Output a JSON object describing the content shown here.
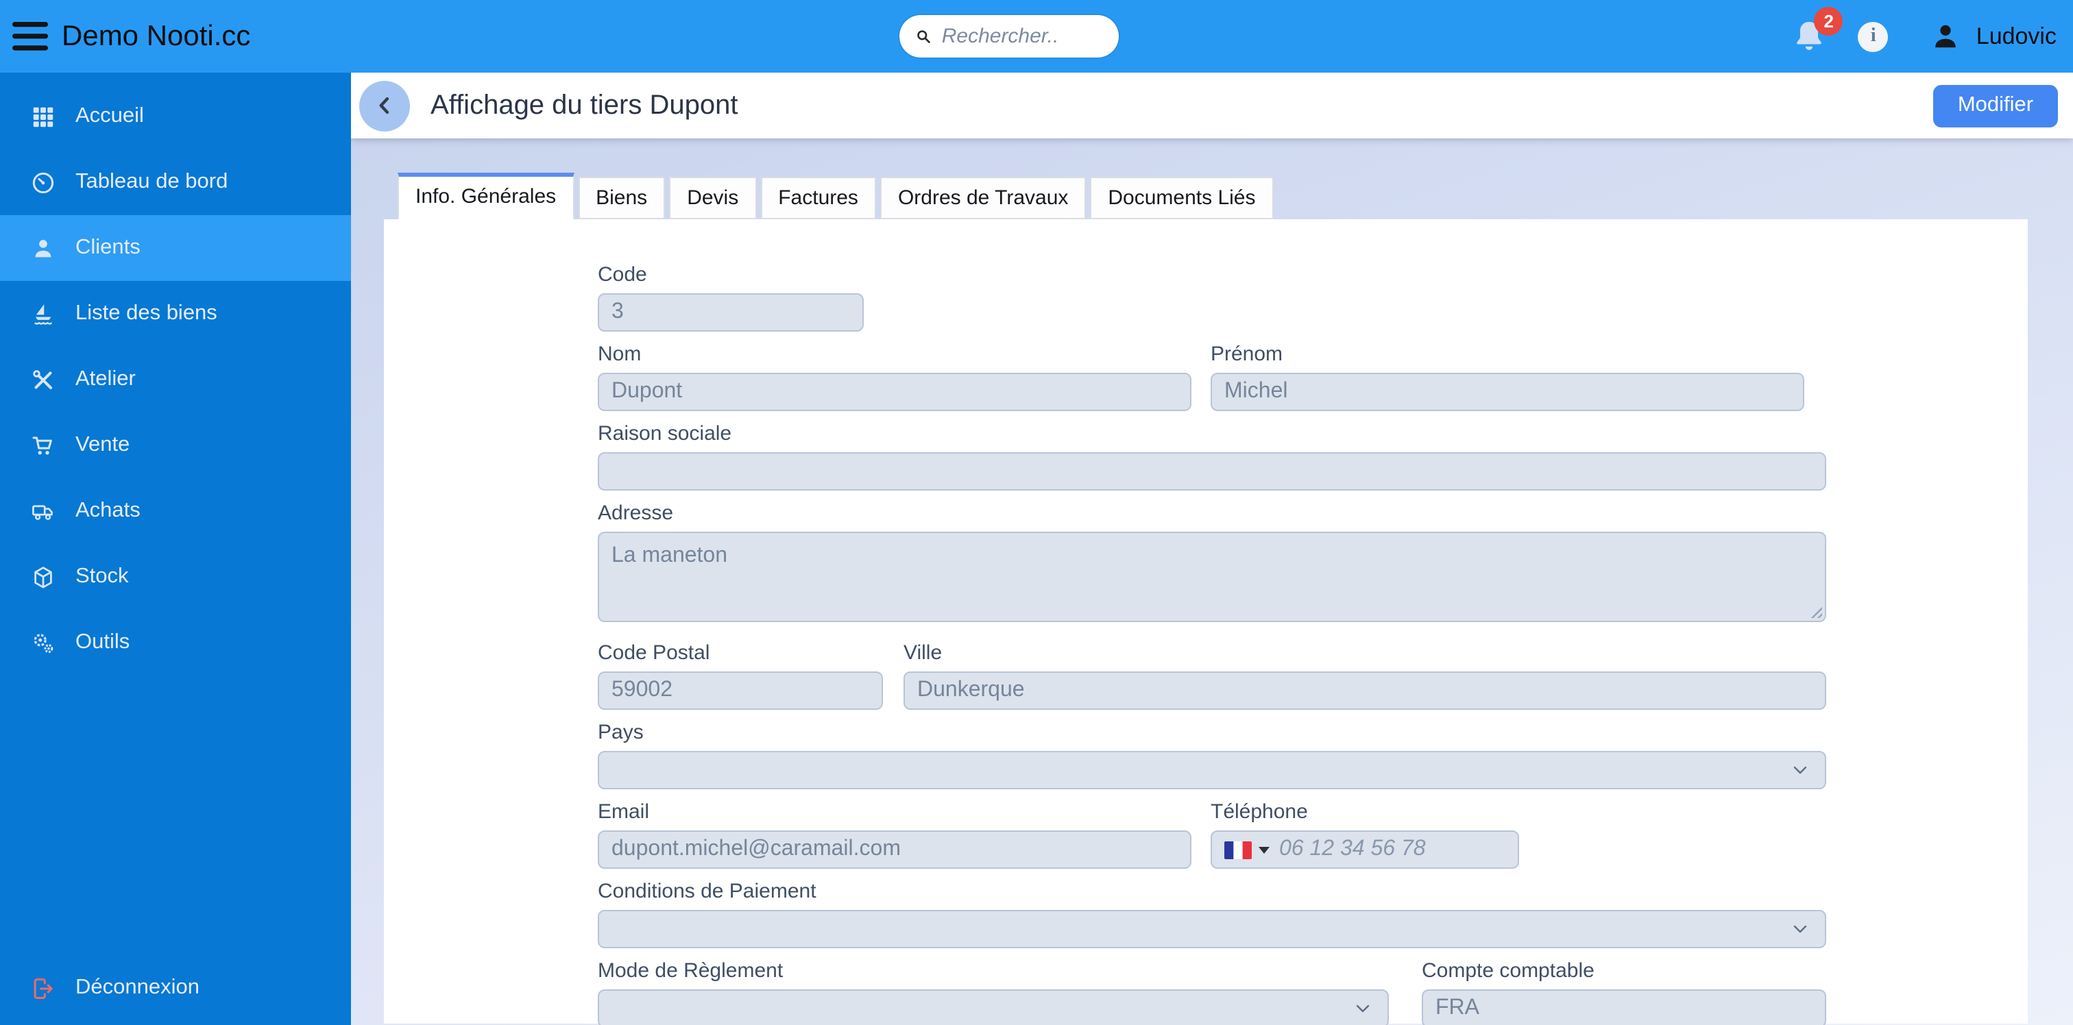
{
  "topbar": {
    "brand": "Demo Nooti.cc",
    "menu_icon": "hamburger-icon",
    "search": {
      "placeholder": "Rechercher..",
      "icon": "search-icon"
    },
    "notifications": {
      "count": "2",
      "icon": "bell-icon"
    },
    "info_icon_glyph": "i",
    "user": {
      "name": "Ludovic",
      "icon": "user-icon"
    }
  },
  "sidebar": {
    "items": [
      {
        "label": "Accueil",
        "icon": "grid-icon",
        "active": false
      },
      {
        "label": "Tableau de bord",
        "icon": "gauge-icon",
        "active": false
      },
      {
        "label": "Clients",
        "icon": "person-icon",
        "active": true
      },
      {
        "label": "Liste des biens",
        "icon": "sailboat-icon",
        "active": false
      },
      {
        "label": "Atelier",
        "icon": "tools-icon",
        "active": false
      },
      {
        "label": "Vente",
        "icon": "cart-icon",
        "active": false
      },
      {
        "label": "Achats",
        "icon": "truck-icon",
        "active": false
      },
      {
        "label": "Stock",
        "icon": "package-icon",
        "active": false
      },
      {
        "label": "Outils",
        "icon": "gears-icon",
        "active": false
      }
    ],
    "logout": {
      "label": "Déconnexion",
      "icon": "logout-icon"
    }
  },
  "page": {
    "title": "Affichage du tiers Dupont",
    "back_icon": "chevron-left-icon",
    "edit_button": "Modifier"
  },
  "tabs": [
    {
      "label": "Info. Générales",
      "active": true
    },
    {
      "label": "Biens",
      "active": false
    },
    {
      "label": "Devis",
      "active": false
    },
    {
      "label": "Factures",
      "active": false
    },
    {
      "label": "Ordres de Travaux",
      "active": false
    },
    {
      "label": "Documents Liés",
      "active": false
    }
  ],
  "form": {
    "code": {
      "label": "Code",
      "value": "3"
    },
    "nom": {
      "label": "Nom",
      "value": "Dupont"
    },
    "prenom": {
      "label": "Prénom",
      "value": "Michel"
    },
    "raison_sociale": {
      "label": "Raison sociale",
      "value": ""
    },
    "adresse": {
      "label": "Adresse",
      "value": "La maneton"
    },
    "code_postal": {
      "label": "Code Postal",
      "value": "59002"
    },
    "ville": {
      "label": "Ville",
      "value": "Dunkerque"
    },
    "pays": {
      "label": "Pays",
      "value": ""
    },
    "email": {
      "label": "Email",
      "value": "dupont.michel@caramail.com"
    },
    "telephone": {
      "label": "Téléphone",
      "placeholder": "06 12 34 56 78",
      "flag": "france-flag-icon"
    },
    "conditions_paiement": {
      "label": "Conditions de Paiement",
      "value": ""
    },
    "mode_reglement": {
      "label": "Mode de Règlement",
      "value": ""
    },
    "compte_comptable": {
      "label": "Compte comptable",
      "value": "FRA"
    }
  },
  "colors": {
    "topbar": "#2899f3",
    "sidebar": "#0778d4",
    "sidebar_active": "#2e9df5",
    "accent_button": "#4486f2",
    "tab_active_border": "#5b8def",
    "badge": "#e8483e",
    "logout_icon": "#ef6a63"
  }
}
